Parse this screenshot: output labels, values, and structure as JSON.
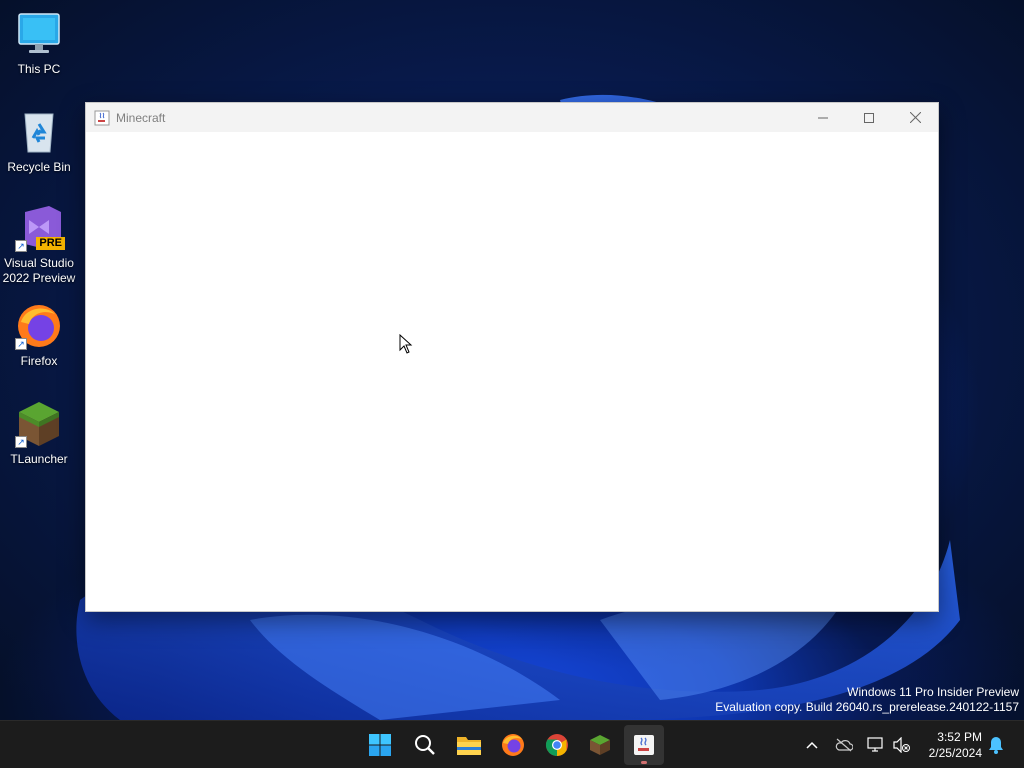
{
  "desktop": {
    "icons": [
      {
        "label": "This PC"
      },
      {
        "label": "Recycle Bin"
      },
      {
        "label": "Visual Studio 2022 Preview",
        "badge": "PRE"
      },
      {
        "label": "Firefox"
      },
      {
        "label": "TLauncher"
      }
    ],
    "shortcut_glyph": "↗"
  },
  "window": {
    "title": "Minecraft",
    "icon": "java-icon",
    "controls": [
      "minimize-icon",
      "maximize-icon",
      "close-icon"
    ]
  },
  "watermark": {
    "line1": "Windows 11 Pro Insider Preview",
    "line2": "Evaluation copy. Build 26040.rs_prerelease.240122-1157"
  },
  "taskbar": {
    "apps": [
      "start-icon",
      "search-icon",
      "file-explorer-icon",
      "firefox-icon",
      "chrome-icon",
      "tlauncher-icon",
      "java-icon"
    ],
    "active_app": "java-icon",
    "tray": [
      "chevron-up-icon",
      "onedrive-offline-icon",
      "network-icon",
      "volume-muted-icon"
    ],
    "time": "3:52 PM",
    "date": "2/25/2024"
  },
  "colors": {
    "accent": "#0078d4",
    "taskbar_bg": "#1c1c1c",
    "window_title_bg": "#f3f3f3"
  }
}
